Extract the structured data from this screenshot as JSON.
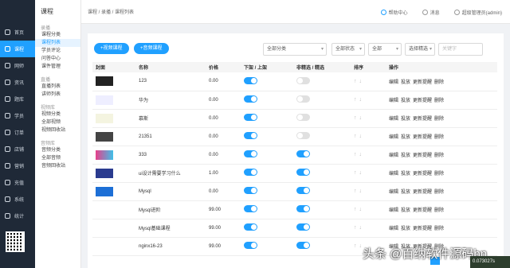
{
  "nav": {
    "items": [
      {
        "label": "首页",
        "active": false
      },
      {
        "label": "课程",
        "active": true
      },
      {
        "label": "网师",
        "active": false
      },
      {
        "label": "资讯",
        "active": false
      },
      {
        "label": "题库",
        "active": false
      },
      {
        "label": "学员",
        "active": false
      },
      {
        "label": "订单",
        "active": false
      },
      {
        "label": "店铺",
        "active": false
      },
      {
        "label": "营销",
        "active": false
      },
      {
        "label": "充值",
        "active": false
      },
      {
        "label": "系统",
        "active": false
      },
      {
        "label": "统计",
        "active": false
      }
    ]
  },
  "subnav": {
    "title": "课程",
    "groups": [
      {
        "label": "录播",
        "items": [
          "课程分类",
          "课程列表",
          "学员评论",
          "问答中心",
          "课件管理"
        ]
      },
      {
        "label": "直播",
        "items": [
          "直播列表",
          "讲师列表"
        ]
      },
      {
        "label": "视频库",
        "items": [
          "视频分类",
          "全部视频",
          "视频回收站"
        ]
      },
      {
        "label": "音频库",
        "items": [
          "音频分类",
          "全部音频",
          "音频回收站"
        ]
      }
    ],
    "active": "课程列表"
  },
  "breadcrumb": "课程 / 录播 / 课程列表",
  "topbar": {
    "help": "帮助中心",
    "message": "消息",
    "user": "超级管理员(admin)"
  },
  "toolbar": {
    "add_video": "+视频课程",
    "add_audio": "+音频课程",
    "category": "全部分类",
    "filter2": "全部状态",
    "filter3": "全部",
    "filter4": "选择精选",
    "search_placeholder": "关键字"
  },
  "table": {
    "headers": [
      "封面",
      "名称",
      "价格",
      "下架 / 上架",
      "非精选 / 精选",
      "排序",
      "操作"
    ],
    "rows": [
      {
        "name": "123",
        "price": "0.00",
        "on": true,
        "featured": false
      },
      {
        "name": "华为",
        "price": "0.00",
        "on": true,
        "featured": false
      },
      {
        "name": "慕斯",
        "price": "0.00",
        "on": true,
        "featured": false
      },
      {
        "name": "21351",
        "price": "0.00",
        "on": true,
        "featured": false
      },
      {
        "name": "333",
        "price": "0.00",
        "on": true,
        "featured": true
      },
      {
        "name": "ui设计需要学习什么",
        "price": "1.00",
        "on": true,
        "featured": true
      },
      {
        "name": "Mysql",
        "price": "0.00",
        "on": true,
        "featured": true
      },
      {
        "name": "Mysql进阶",
        "price": "99.00",
        "on": true,
        "featured": true
      },
      {
        "name": "Mysql基础课程",
        "price": "99.00",
        "on": true,
        "featured": true
      },
      {
        "name": "nginx16-23",
        "price": "99.00",
        "on": true,
        "featured": true
      }
    ],
    "ops": [
      "编辑",
      "投放",
      "更新提醒",
      "删除"
    ],
    "sort": [
      "↑",
      "↓"
    ]
  },
  "watermark": "头条 @百纳软件源码bn",
  "badge": "0.073027s"
}
